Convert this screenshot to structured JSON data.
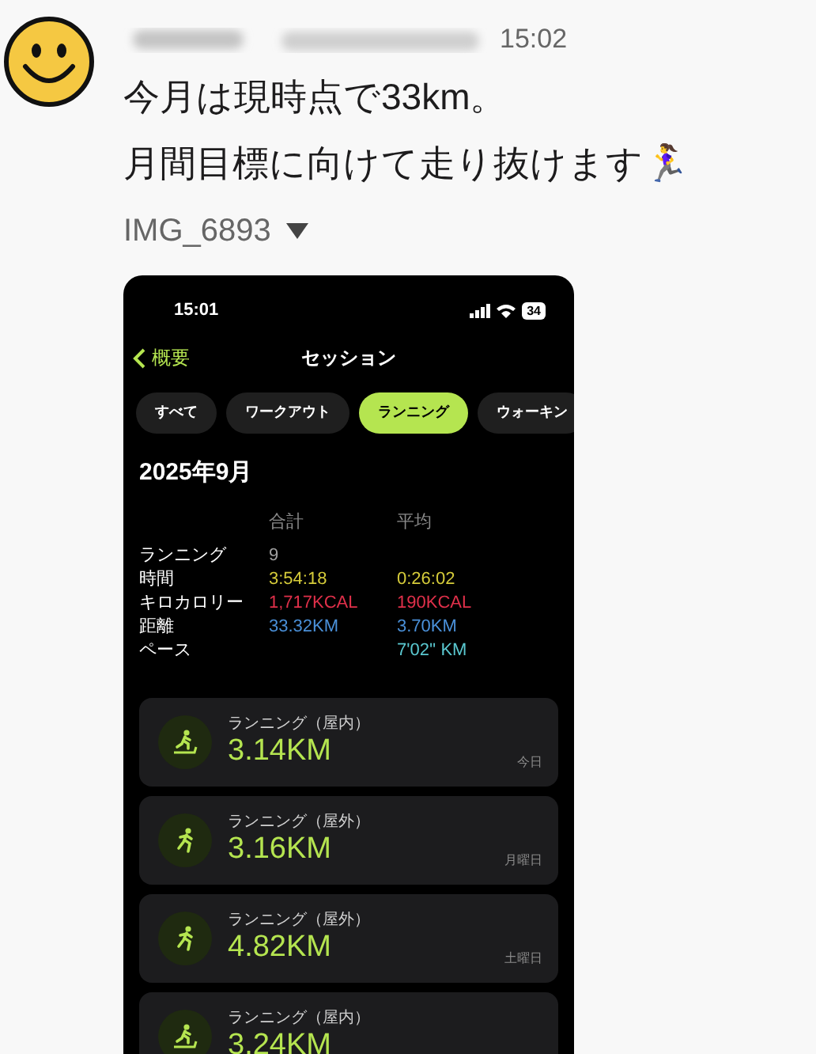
{
  "message": {
    "time": "15:02",
    "lines": [
      "今月は現時点で33km。",
      "月間目標に向けて走り抜けます🏃‍♀️"
    ],
    "attachment": {
      "name": "IMG_6893",
      "expanded": true
    }
  },
  "phone": {
    "status_time": "15:01",
    "battery": "34",
    "nav": {
      "back": "概要",
      "title": "セッション"
    },
    "tabs": [
      {
        "label": "すべて",
        "selected": false
      },
      {
        "label": "ワークアウト",
        "selected": false
      },
      {
        "label": "ランニング",
        "selected": true
      },
      {
        "label": "ウォーキン",
        "selected": false
      }
    ],
    "period": "2025年9月",
    "stats": {
      "columns": [
        "合計",
        "平均"
      ],
      "rows": [
        {
          "label": "ランニング",
          "total": "9",
          "color": "#a0a0a0"
        },
        {
          "label": "時間",
          "total": "3:54:18",
          "average": "0:26:02",
          "color": "#d6cc3a"
        },
        {
          "label": "キロカロリー",
          "total": "1,717KCAL",
          "average": "190KCAL",
          "color": "#e0304a"
        },
        {
          "label": "距離",
          "total": "33.32KM",
          "average": "3.70KM",
          "color": "#4a90d9"
        },
        {
          "label": "ペース",
          "average": "7'02'' KM",
          "color": "#5ac8d0"
        }
      ]
    },
    "sessions": [
      {
        "kind": "indoor",
        "title": "ランニング（屋内）",
        "distance": "3.14KM",
        "day": "今日"
      },
      {
        "kind": "outdoor",
        "title": "ランニング（屋外）",
        "distance": "3.16KM",
        "day": "月曜日"
      },
      {
        "kind": "outdoor",
        "title": "ランニング（屋外）",
        "distance": "4.82KM",
        "day": "土曜日"
      },
      {
        "kind": "indoor",
        "title": "ランニング（屋内）",
        "distance": "3.24KM"
      }
    ]
  }
}
